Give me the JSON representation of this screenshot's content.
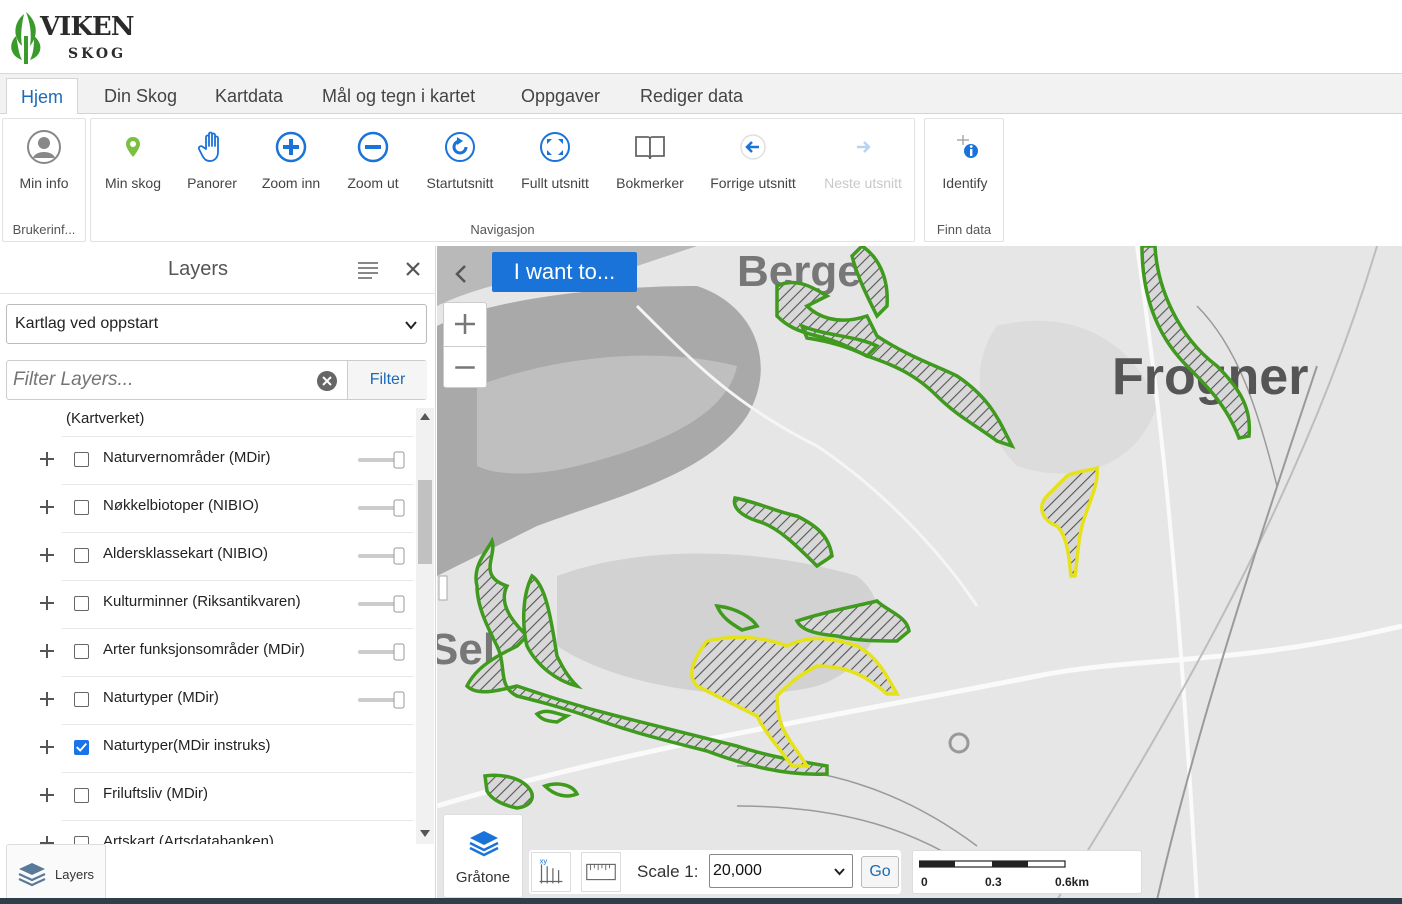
{
  "logo": {
    "line1": "VIKEN",
    "line2": "SKOG",
    "brand_color": "#3a9a2a"
  },
  "tabs": [
    {
      "label": "Hjem",
      "active": true
    },
    {
      "label": "Din Skog"
    },
    {
      "label": "Kartdata"
    },
    {
      "label": "Mål og tegn i kartet"
    },
    {
      "label": "Oppgaver"
    },
    {
      "label": "Rediger data"
    }
  ],
  "ribbon": {
    "groups": [
      {
        "label": "Brukerinf...",
        "tools": [
          {
            "label": "Min info",
            "icon": "user-icon"
          }
        ]
      },
      {
        "label": "Navigasjon",
        "tools": [
          {
            "label": "Min skog",
            "icon": "map-pin-icon"
          },
          {
            "label": "Panorer",
            "icon": "hand-icon"
          },
          {
            "label": "Zoom inn",
            "icon": "zoom-in-icon"
          },
          {
            "label": "Zoom ut",
            "icon": "zoom-out-icon"
          },
          {
            "label": "Startutsnitt",
            "icon": "refresh-icon"
          },
          {
            "label": "Fullt utsnitt",
            "icon": "full-extent-icon"
          },
          {
            "label": "Bokmerker",
            "icon": "book-icon"
          },
          {
            "label": "Forrige utsnitt",
            "icon": "arrow-left-icon"
          },
          {
            "label": "Neste utsnitt",
            "icon": "arrow-right-icon",
            "disabled": true
          }
        ]
      },
      {
        "label": "Finn data",
        "tools": [
          {
            "label": "Identify",
            "icon": "identify-icon"
          }
        ]
      }
    ]
  },
  "layers_panel": {
    "title": "Layers",
    "select_value": "Kartlag ved oppstart",
    "filter_placeholder": "Filter Layers...",
    "filter_button": "Filter",
    "list_caption": "(Kartverket)",
    "layers": [
      {
        "name": "Naturvernområder (MDir)",
        "checked": false,
        "slider": true
      },
      {
        "name": "Nøkkelbiotoper (NIBIO)",
        "checked": false,
        "slider": true
      },
      {
        "name": "Aldersklassekart (NIBIO)",
        "checked": false,
        "slider": true
      },
      {
        "name": "Kulturminner (Riksantikvaren)",
        "checked": false,
        "slider": true
      },
      {
        "name": "Arter funksjonsområder (MDir)",
        "checked": false,
        "slider": true
      },
      {
        "name": "Naturtyper (MDir)",
        "checked": false,
        "slider": true
      },
      {
        "name": "Naturtyper(MDir instruks)",
        "checked": true,
        "slider": false
      },
      {
        "name": "Friluftsliv (MDir)",
        "checked": false,
        "slider": false
      },
      {
        "name": "Artskart (Artsdatabanken)",
        "checked": false,
        "slider": false
      }
    ],
    "footer_button": "Layers"
  },
  "map": {
    "iwant_label": "I want to...",
    "place_labels": [
      "Berger",
      "Frogner",
      "Sel"
    ],
    "basemap_label": "Gråtone",
    "scale_label": "Scale 1:",
    "scale_value": "20,000",
    "go_label": "Go",
    "scalebar_ticks": [
      "0",
      "0.3",
      "0.6km"
    ],
    "colors": {
      "green": "#3f9a1e",
      "yellow": "#e6e21a",
      "accent": "#1a73d9"
    }
  }
}
